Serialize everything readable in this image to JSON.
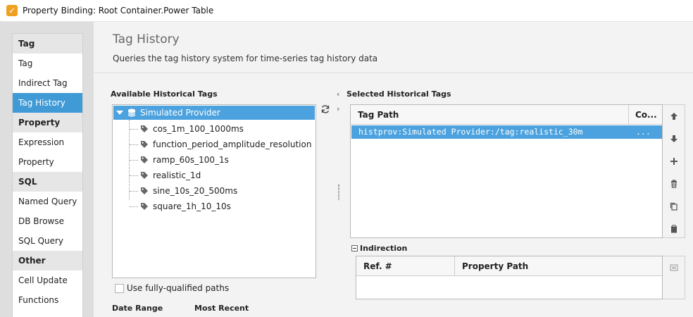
{
  "window": {
    "title": "Property Binding: Root Container.Power Table"
  },
  "nav": {
    "groups": [
      {
        "label": "Tag",
        "items": [
          "Tag",
          "Indirect Tag",
          "Tag History"
        ]
      },
      {
        "label": "Property",
        "items": [
          "Expression",
          "Property"
        ]
      },
      {
        "label": "SQL",
        "items": [
          "Named Query",
          "DB Browse",
          "SQL Query"
        ]
      },
      {
        "label": "Other",
        "items": [
          "Cell Update",
          "Functions"
        ]
      }
    ],
    "selected": "Tag History"
  },
  "header": {
    "title": "Tag History",
    "description": "Queries the tag history system for time-series tag history data"
  },
  "available": {
    "label": "Available Historical Tags",
    "root": "Simulated Provider",
    "tags": [
      "cos_1m_100_1000ms",
      "function_period_amplitude_resolution",
      "ramp_60s_100_1s",
      "realistic_1d",
      "sine_10s_20_500ms",
      "square_1h_10_10s"
    ],
    "fully_qualified_label": "Use fully-qualified paths",
    "fully_qualified_checked": false
  },
  "selected_tags": {
    "label": "Selected Historical Tags",
    "columns": [
      "Tag Path",
      "Co..."
    ],
    "rows": [
      {
        "path": "histprov:Simulated Provider:/tag:realistic_30m",
        "config": "..."
      }
    ]
  },
  "indirection": {
    "label": "Indirection",
    "columns": [
      "Ref. #",
      "Property Path"
    ]
  },
  "bottom": {
    "date_range_label": "Date Range",
    "most_recent_label": "Most Recent"
  },
  "icons": [
    "refresh-icon",
    "move-up-icon",
    "move-down-icon",
    "add-icon",
    "delete-icon",
    "copy-icon",
    "paste-icon",
    "edit-icon"
  ],
  "colors": {
    "selection": "#4ba2de",
    "nav_selected": "#3f9ad6",
    "accent": "#f0a020"
  }
}
